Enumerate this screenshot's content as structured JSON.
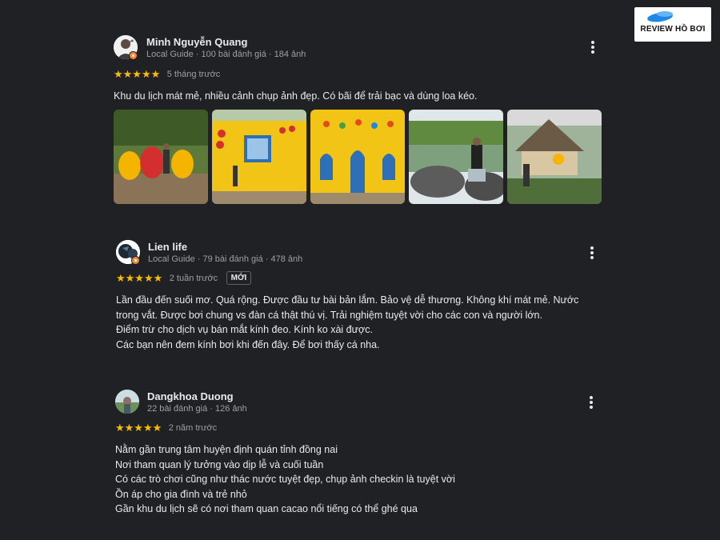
{
  "logo": {
    "text": "REVIEW HỒ BƠI",
    "icon": "water-drop-logo",
    "colors": [
      "#1e88e5",
      "#64b5f6"
    ]
  },
  "reviews": [
    {
      "name": "Minh Nguyễn Quang",
      "meta": "Local Guide · 100 bài đánh giá · 184 ảnh",
      "stars": "★★★★★",
      "rating": 5,
      "time": "5 tháng trước",
      "text": [
        "Khu du lịch mát mẻ, nhiều cảnh chụp ảnh đẹp. Có bãi để trải bạc và dùng loa kéo."
      ],
      "photos": [
        "photo-egg-statues",
        "photo-yellow-house-window",
        "photo-yellow-house-door",
        "photo-lake-rocks",
        "photo-thatched-hut"
      ]
    },
    {
      "name": "Lien life",
      "meta": "Local Guide · 79 bài đánh giá · 478 ảnh",
      "stars": "★★★★★",
      "rating": 5,
      "time": "2 tuần trước",
      "tag": "MỚI",
      "text": [
        "Lần đầu đến suối mơ. Quá rộng. Được đầu tư bài bản lắm. Bảo vệ dễ thương. Không khí mát mẻ. Nước",
        "trong vắt. Được bơi chung vs đàn cá thật thú vị. Trải nghiệm tuyệt vời cho các con và người lớn.",
        "Điểm trừ cho dịch vụ bán mắt kính đeo. Kính ko xài được.",
        "Các bạn nên đem kính bơi khi đến đây. Để bơi thấy cá nha."
      ]
    },
    {
      "name": "Dangkhoa Duong",
      "meta": "22 bài đánh giá · 126 ảnh",
      "stars": "★★★★★",
      "rating": 5,
      "time": "2 năm trước",
      "text": [
        "Nằm gần trung tâm huyện định quán tỉnh đồng nai",
        "Nơi tham quan lý tưởng vào dịp lễ và cuối tuần",
        "Có các trò chơi cũng như thác nước tuyệt đẹp, chụp ảnh checkin là tuyệt vời",
        "Ồn áp cho gia đình và trẻ nhỏ",
        "Gần khu du lịch sẽ có nơi tham quan cacao nổi tiếng có thể ghé qua"
      ]
    }
  ]
}
